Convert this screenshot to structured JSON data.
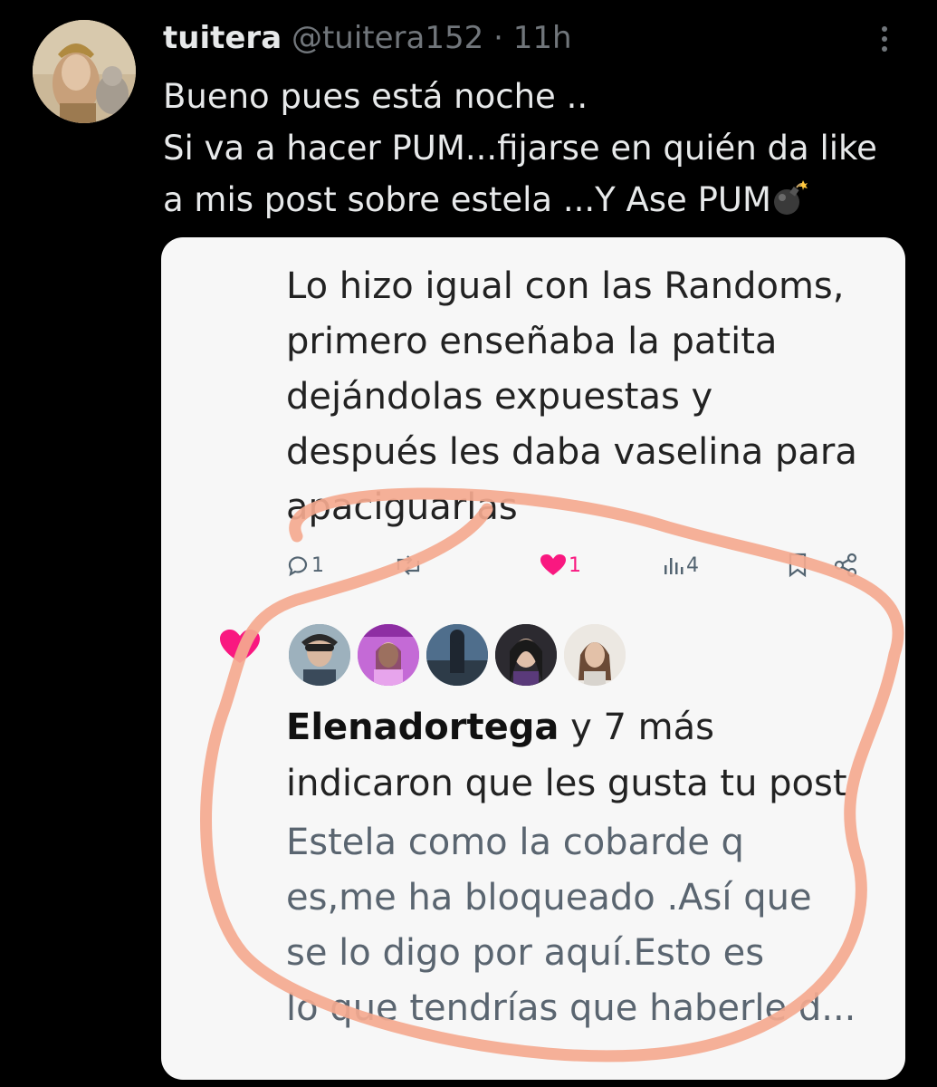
{
  "tweet": {
    "display_name": "tuitera",
    "handle": "@tuitera152",
    "separator": "·",
    "time": "11h",
    "lines": [
      "Bueno pues está noche ..",
      "Si va a hacer PUM...fijarse en quién da like",
      "a mis post sobre estela ...Y Ase PUM"
    ],
    "more_icon": "more-vertical-icon"
  },
  "screenshot": {
    "post_lines": [
      "Lo hizo igual con las Randoms,",
      "primero enseñaba la patita",
      "dejándolas expuestas y",
      "después les daba vaselina para",
      "apaciguarlas"
    ],
    "actions": {
      "reply_count": "1",
      "like_count": "1",
      "views_count": "4"
    },
    "notification": {
      "user": "Elenadortega",
      "suffix": " y 7 más",
      "line2": "indicaron que les gusta tu post",
      "liked_post_lines": [
        "Estela como la cobarde q",
        "es,me ha bloqueado .Así que",
        "se lo digo por aquí.Esto es",
        "lo que tendrías que haberle d..."
      ]
    }
  },
  "colors": {
    "background": "#000000",
    "like_pink": "#f91880",
    "circle_annotation": "#f4a98f"
  }
}
